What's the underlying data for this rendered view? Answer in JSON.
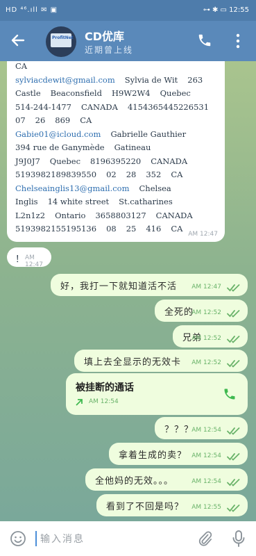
{
  "status": {
    "left": "HD ⁴⁶.ıll ✉ ▣",
    "right": "⊶ ✱ ▭ 12:55"
  },
  "header": {
    "title": "CD优库",
    "subtitle": "近期曾上线",
    "avatar_text": "ProfitNet"
  },
  "long_message": {
    "lines": [
      {
        "parts": [
          "CA"
        ]
      },
      {
        "email": "sylviacdewit@gmail.com",
        "parts": [
          "Sylvia de Wit",
          "263"
        ]
      },
      {
        "parts": [
          "Castle",
          "Beaconsfield",
          "H9W2W4",
          "Quebec"
        ]
      },
      {
        "parts": [
          "514-244-1477",
          "CANADA",
          "4154365445226531"
        ]
      },
      {
        "parts": [
          "07",
          "26",
          "869",
          "CA"
        ]
      },
      {
        "email": "Gabie01@icloud.com",
        "parts": [
          "Gabrielle Gauthier"
        ]
      },
      {
        "parts": [
          "394 rue de Ganymède",
          "Gatineau"
        ]
      },
      {
        "parts": [
          "J9J0J7",
          "Quebec",
          "8196395220",
          "CANADA"
        ]
      },
      {
        "parts": [
          "5193982189839550",
          "02",
          "28",
          "352",
          "CA"
        ]
      },
      {
        "email": "Chelseainglis13@gmail.com",
        "parts": [
          "Chelsea"
        ]
      },
      {
        "parts": [
          "Inglis",
          "14 white street",
          "St.catharines"
        ]
      },
      {
        "parts": [
          "L2n1z2",
          "Ontario",
          "3658803127",
          "CANADA"
        ]
      },
      {
        "parts": [
          "5193982155195136",
          "08",
          "25",
          "416",
          "CA"
        ]
      }
    ],
    "time": "AM 12:47"
  },
  "small_in": {
    "text": "！",
    "time": "AM 12:47"
  },
  "outgoing": [
    {
      "text": "好，我打一下就知道活不活",
      "time": "AM 12:47"
    },
    {
      "text": "全死的",
      "time": "AM 12:52"
    },
    {
      "text": "兄弟",
      "time": "AM 12:52"
    },
    {
      "text": "填上去全显示的无效卡",
      "time": "AM 12:52"
    },
    {
      "text": "？？？",
      "time": "AM 12:54"
    },
    {
      "text": "拿着生成的卖？",
      "time": "AM 12:54"
    },
    {
      "text": "全他妈的无效。。。",
      "time": "AM 12:54"
    },
    {
      "text": "看到了不回是吗？",
      "time": "AM 12:55"
    }
  ],
  "call_card": {
    "title": "被挂断的通话",
    "time": "AM 12:54"
  },
  "input": {
    "placeholder": "输入消息"
  },
  "colors": {
    "header": "#5a89ba",
    "outgoing": "#effdde",
    "check": "#6ab36a"
  }
}
